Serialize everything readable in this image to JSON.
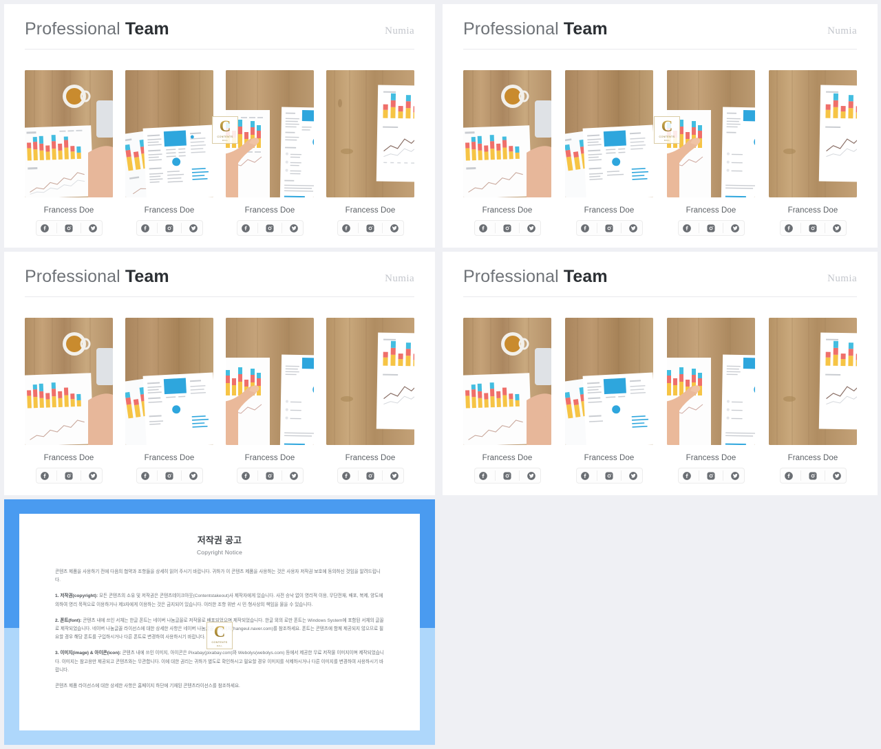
{
  "background_color": "#eff0f4",
  "accent_color": "#4a9bf0",
  "accent_color_light": "#aed7fb",
  "slides": [
    {
      "title_light": "Professional",
      "title_bold": "Team",
      "brand": "Numia"
    },
    {
      "title_light": "Professional",
      "title_bold": "Team",
      "brand": "Numia"
    },
    {
      "title_light": "Professional",
      "title_bold": "Team",
      "brand": "Numia"
    },
    {
      "title_light": "Professional",
      "title_bold": "Team",
      "brand": "Numia"
    }
  ],
  "team": {
    "members": [
      {
        "name": "Francess Doe",
        "photo": "coffee-cup-and-bar-chart-report-on-wood-desk"
      },
      {
        "name": "Francess Doe",
        "photo": "blue-infographic-brochure-documents-on-wood-desk"
      },
      {
        "name": "Francess Doe",
        "photo": "hand-pointing-at-bar-chart-report-on-wood-desk"
      },
      {
        "name": "Francess Doe",
        "photo": "vertical-chart-report-on-wood-desk"
      }
    ],
    "social_icons": [
      {
        "name": "facebook-icon",
        "label": "Facebook"
      },
      {
        "name": "instagram-icon",
        "label": "Instagram"
      },
      {
        "name": "twitter-icon",
        "label": "Twitter"
      }
    ]
  },
  "watermark": {
    "letter": "C",
    "line1": "CONTENTS",
    "line2": "MALL"
  },
  "copyright": {
    "title": "저작권 공고",
    "subtitle": "Copyright Notice",
    "paragraphs": [
      {
        "lead": "",
        "text": "콘텐츠 제품을 사용하기 전에 다음의 협약과 조항들을 상세히 읽어 주시기 바랍니다. 귀하가 이 콘텐츠 제품을 사용하는 것은 사용자 저작권 보호에 동의하신 것임을 알려드립니다."
      },
      {
        "lead": "1. 저작권(copyright):",
        "text": " 모든 콘텐츠의 소유 및 저작권은 콘텐츠테이크아웃(Contentstakeout)사 제작자에게 있습니다. 사전 승낙 없이 영리적 이용, 무단전재, 배포, 복제, 양도에 의하여 영리 목적으로 이용하거나 제3자에게 이용하는 것은 금지되어 있습니다. 이러한 조항 위반 시 민·형사상의 책임을 물을 수 있습니다."
      },
      {
        "lead": "2. 폰트(font):",
        "text": " 콘텐츠 내에 쓰인 서체는 한글 폰트는 네이버 나눔글꼴로 저작물로 배포되었으며 제작되었습니다. 한글 외의 로만 폰트는 Windows System에 포함된 서체의 글꼴로 제작되었습니다. 네이버 나눔글꼴 라이선스에 대한 상세한 사항은 네이버 나눔글꼴 홈페이지(hangeul.naver.com)를 참조하세요. 폰트는 콘텐츠에 함께 제공되지 않으므로 필요할 경우 해당 폰트를 구입하시거나 다른 폰트로 변경하여 사용하시기 바랍니다."
      },
      {
        "lead": "3. 이미지(image) & 아이콘(icon):",
        "text": " 콘텐츠 내에 쓰인 이미지, 아이콘은 Pixabay(pixabay.com)와 Webolys(webolys.com) 등에서 제공한 무료 저작물 이미지이며 제작되었습니다. 이미지는 참고용만 제공되고 콘텐츠와는 무관합니다. 이에 대한 권리는 귀하가 별도로 확인하시고 필요할 경우 이미지를 삭제하시거나 다른 이미지를 변경하여 사용하시기 바랍니다."
      },
      {
        "lead": "",
        "text": "콘텐츠 제품 라이선스에 대한 상세한 사항은 홈페이지 하단에 기재된 콘텐츠라이선스를 참조하세요."
      }
    ]
  }
}
